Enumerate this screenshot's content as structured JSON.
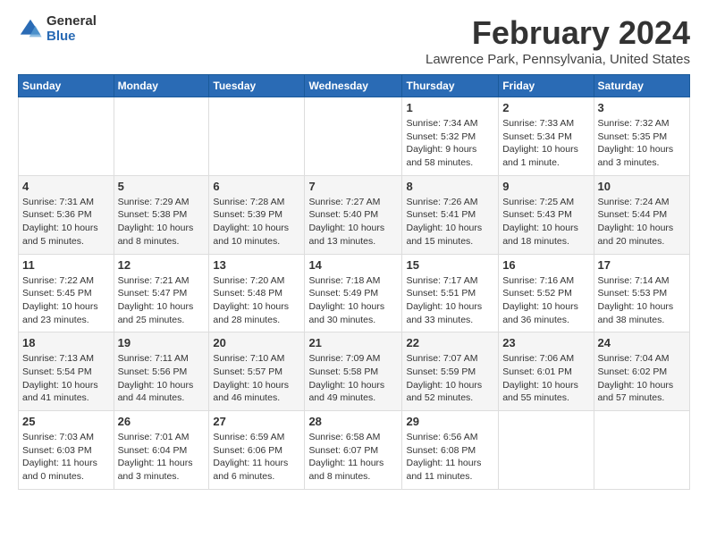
{
  "header": {
    "logo_general": "General",
    "logo_blue": "Blue",
    "month_title": "February 2024",
    "location": "Lawrence Park, Pennsylvania, United States"
  },
  "weekdays": [
    "Sunday",
    "Monday",
    "Tuesday",
    "Wednesday",
    "Thursday",
    "Friday",
    "Saturday"
  ],
  "weeks": [
    [
      {
        "day": "",
        "info": ""
      },
      {
        "day": "",
        "info": ""
      },
      {
        "day": "",
        "info": ""
      },
      {
        "day": "",
        "info": ""
      },
      {
        "day": "1",
        "info": "Sunrise: 7:34 AM\nSunset: 5:32 PM\nDaylight: 9 hours and 58 minutes."
      },
      {
        "day": "2",
        "info": "Sunrise: 7:33 AM\nSunset: 5:34 PM\nDaylight: 10 hours and 1 minute."
      },
      {
        "day": "3",
        "info": "Sunrise: 7:32 AM\nSunset: 5:35 PM\nDaylight: 10 hours and 3 minutes."
      }
    ],
    [
      {
        "day": "4",
        "info": "Sunrise: 7:31 AM\nSunset: 5:36 PM\nDaylight: 10 hours and 5 minutes."
      },
      {
        "day": "5",
        "info": "Sunrise: 7:29 AM\nSunset: 5:38 PM\nDaylight: 10 hours and 8 minutes."
      },
      {
        "day": "6",
        "info": "Sunrise: 7:28 AM\nSunset: 5:39 PM\nDaylight: 10 hours and 10 minutes."
      },
      {
        "day": "7",
        "info": "Sunrise: 7:27 AM\nSunset: 5:40 PM\nDaylight: 10 hours and 13 minutes."
      },
      {
        "day": "8",
        "info": "Sunrise: 7:26 AM\nSunset: 5:41 PM\nDaylight: 10 hours and 15 minutes."
      },
      {
        "day": "9",
        "info": "Sunrise: 7:25 AM\nSunset: 5:43 PM\nDaylight: 10 hours and 18 minutes."
      },
      {
        "day": "10",
        "info": "Sunrise: 7:24 AM\nSunset: 5:44 PM\nDaylight: 10 hours and 20 minutes."
      }
    ],
    [
      {
        "day": "11",
        "info": "Sunrise: 7:22 AM\nSunset: 5:45 PM\nDaylight: 10 hours and 23 minutes."
      },
      {
        "day": "12",
        "info": "Sunrise: 7:21 AM\nSunset: 5:47 PM\nDaylight: 10 hours and 25 minutes."
      },
      {
        "day": "13",
        "info": "Sunrise: 7:20 AM\nSunset: 5:48 PM\nDaylight: 10 hours and 28 minutes."
      },
      {
        "day": "14",
        "info": "Sunrise: 7:18 AM\nSunset: 5:49 PM\nDaylight: 10 hours and 30 minutes."
      },
      {
        "day": "15",
        "info": "Sunrise: 7:17 AM\nSunset: 5:51 PM\nDaylight: 10 hours and 33 minutes."
      },
      {
        "day": "16",
        "info": "Sunrise: 7:16 AM\nSunset: 5:52 PM\nDaylight: 10 hours and 36 minutes."
      },
      {
        "day": "17",
        "info": "Sunrise: 7:14 AM\nSunset: 5:53 PM\nDaylight: 10 hours and 38 minutes."
      }
    ],
    [
      {
        "day": "18",
        "info": "Sunrise: 7:13 AM\nSunset: 5:54 PM\nDaylight: 10 hours and 41 minutes."
      },
      {
        "day": "19",
        "info": "Sunrise: 7:11 AM\nSunset: 5:56 PM\nDaylight: 10 hours and 44 minutes."
      },
      {
        "day": "20",
        "info": "Sunrise: 7:10 AM\nSunset: 5:57 PM\nDaylight: 10 hours and 46 minutes."
      },
      {
        "day": "21",
        "info": "Sunrise: 7:09 AM\nSunset: 5:58 PM\nDaylight: 10 hours and 49 minutes."
      },
      {
        "day": "22",
        "info": "Sunrise: 7:07 AM\nSunset: 5:59 PM\nDaylight: 10 hours and 52 minutes."
      },
      {
        "day": "23",
        "info": "Sunrise: 7:06 AM\nSunset: 6:01 PM\nDaylight: 10 hours and 55 minutes."
      },
      {
        "day": "24",
        "info": "Sunrise: 7:04 AM\nSunset: 6:02 PM\nDaylight: 10 hours and 57 minutes."
      }
    ],
    [
      {
        "day": "25",
        "info": "Sunrise: 7:03 AM\nSunset: 6:03 PM\nDaylight: 11 hours and 0 minutes."
      },
      {
        "day": "26",
        "info": "Sunrise: 7:01 AM\nSunset: 6:04 PM\nDaylight: 11 hours and 3 minutes."
      },
      {
        "day": "27",
        "info": "Sunrise: 6:59 AM\nSunset: 6:06 PM\nDaylight: 11 hours and 6 minutes."
      },
      {
        "day": "28",
        "info": "Sunrise: 6:58 AM\nSunset: 6:07 PM\nDaylight: 11 hours and 8 minutes."
      },
      {
        "day": "29",
        "info": "Sunrise: 6:56 AM\nSunset: 6:08 PM\nDaylight: 11 hours and 11 minutes."
      },
      {
        "day": "",
        "info": ""
      },
      {
        "day": "",
        "info": ""
      }
    ]
  ]
}
